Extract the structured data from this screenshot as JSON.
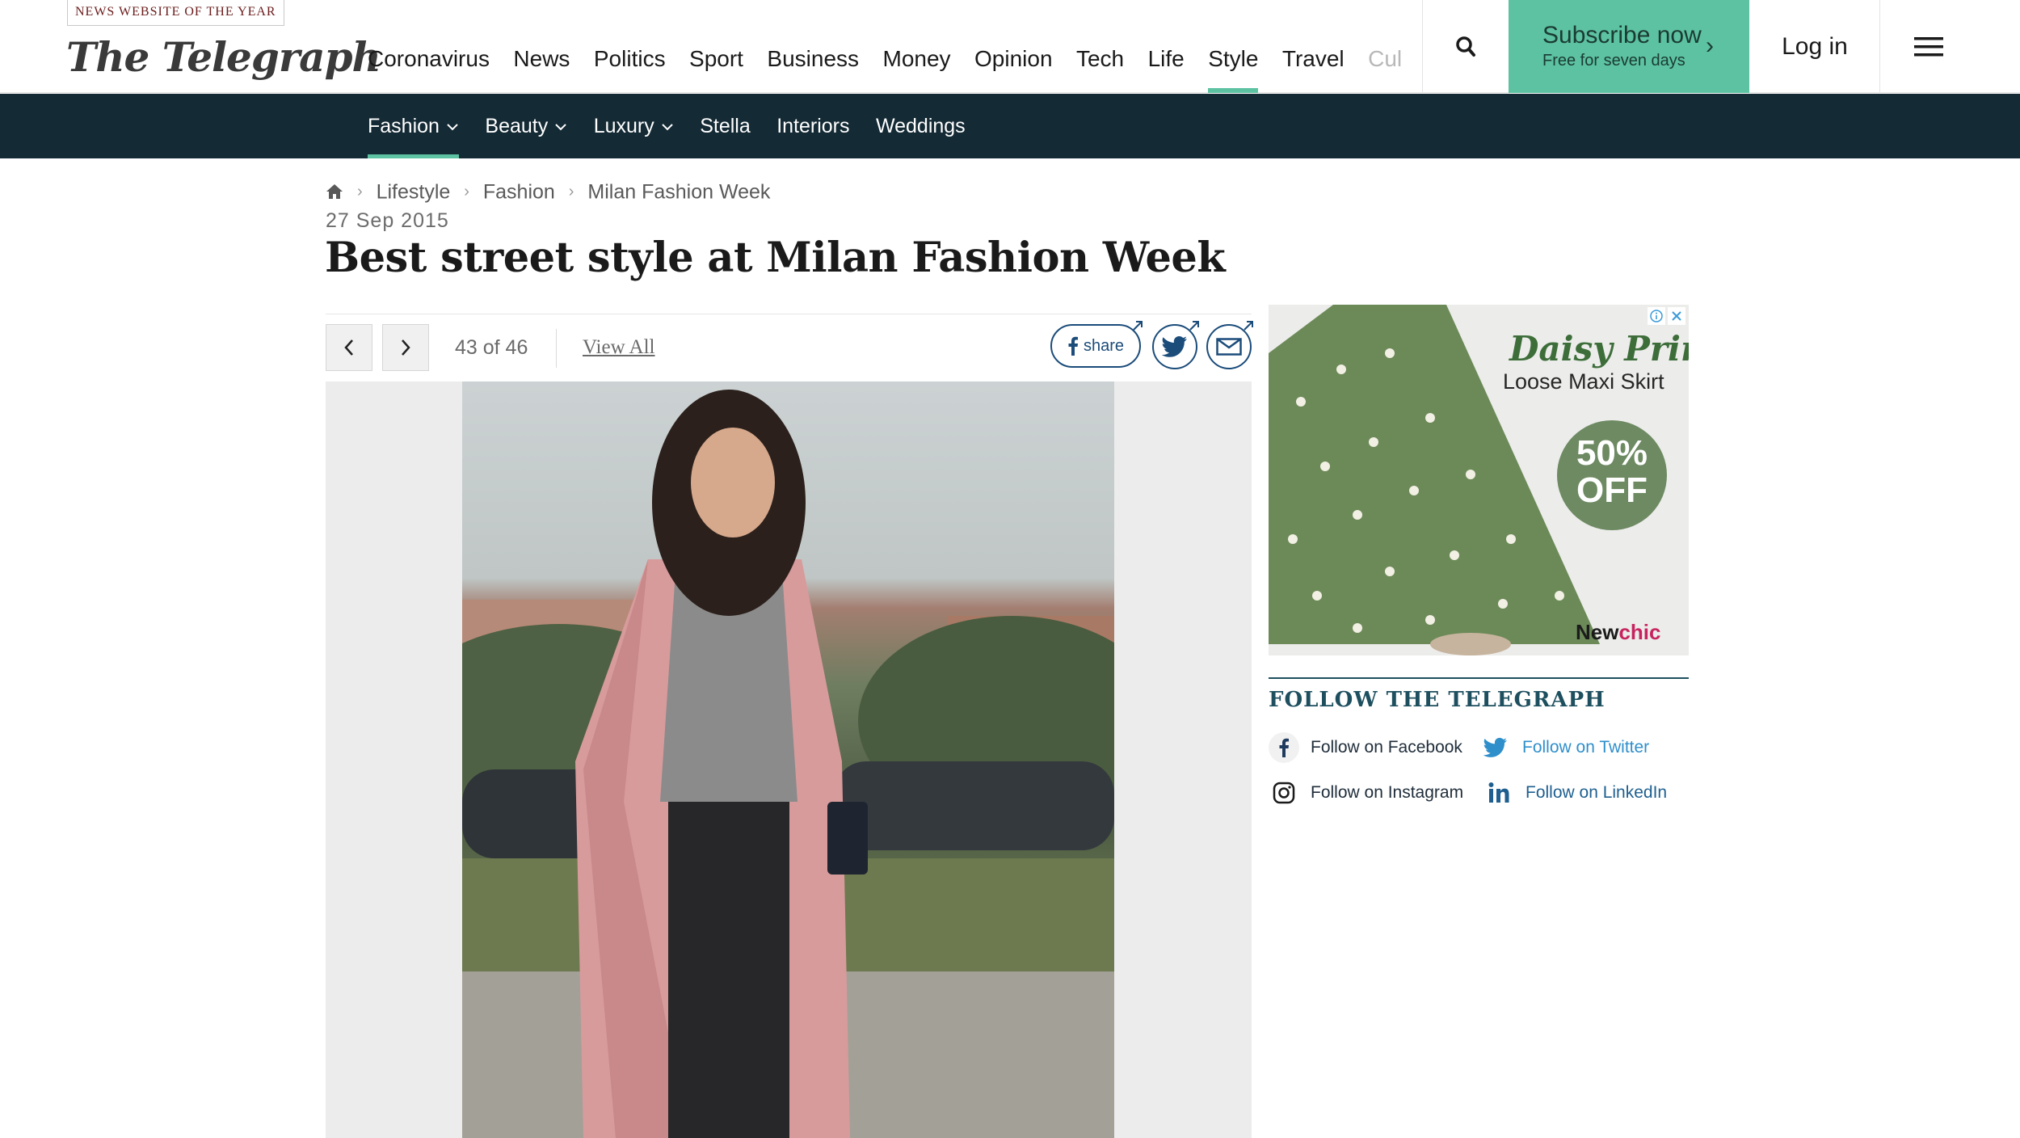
{
  "header": {
    "award": "NEWS WEBSITE OF THE YEAR",
    "logo": "The Telegraph",
    "nav": [
      "Coronavirus",
      "News",
      "Politics",
      "Sport",
      "Business",
      "Money",
      "Opinion",
      "Tech",
      "Life",
      "Style",
      "Travel",
      "Cul"
    ],
    "active_nav": "Style",
    "subscribe_title": "Subscribe now",
    "subscribe_sub": "Free for seven days",
    "login": "Log in",
    "icons": {
      "search": "search-icon",
      "menu": "hamburger-menu-icon"
    },
    "accent_color": "#5dc2a2"
  },
  "subnav": {
    "items": [
      {
        "label": "Fashion",
        "dropdown": true,
        "active": true
      },
      {
        "label": "Beauty",
        "dropdown": true
      },
      {
        "label": "Luxury",
        "dropdown": true
      },
      {
        "label": "Stella"
      },
      {
        "label": "Interiors"
      },
      {
        "label": "Weddings"
      }
    ],
    "background": "#142a35"
  },
  "breadcrumb": [
    "Lifestyle",
    "Fashion",
    "Milan Fashion Week"
  ],
  "article": {
    "date": "27 Sep 2015",
    "headline": "Best street style at Milan Fashion Week"
  },
  "gallery": {
    "counter": "43 of 46",
    "view_all": "View All",
    "share_label": "share"
  },
  "ad": {
    "title": "Daisy Print",
    "subtitle": "Loose Maxi Skirt",
    "offer_line1": "50%",
    "offer_line2": "OFF",
    "brand_part1": "New",
    "brand_part2": "chic"
  },
  "follow": {
    "heading": "FOLLOW THE TELEGRAPH",
    "facebook": "Follow on Facebook",
    "twitter": "Follow on Twitter",
    "instagram": "Follow on Instagram",
    "linkedin": "Follow on LinkedIn"
  }
}
